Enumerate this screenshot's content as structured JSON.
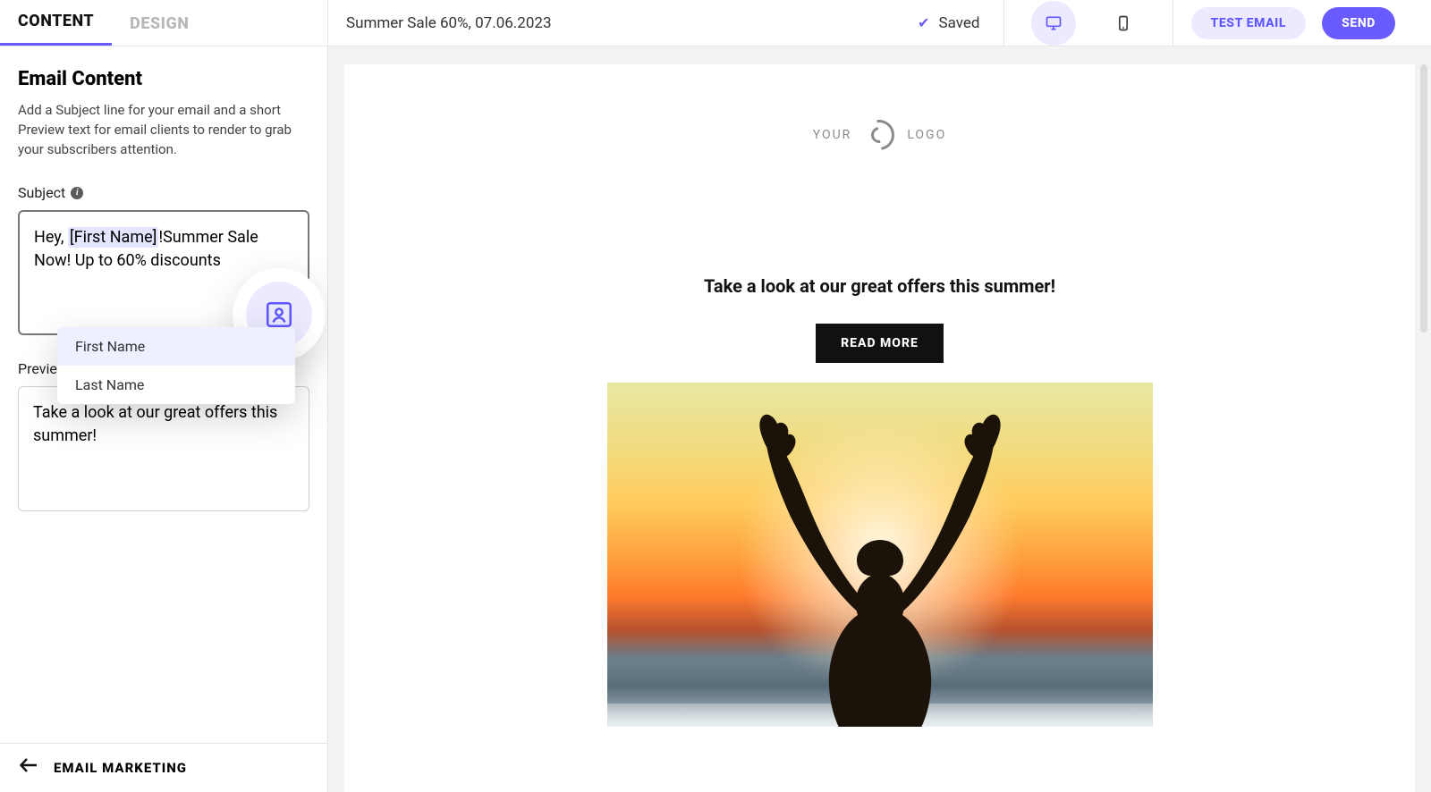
{
  "sidebar": {
    "tabs": {
      "content": "CONTENT",
      "design": "DESIGN"
    },
    "panel_title": "Email Content",
    "panel_desc": "Add a Subject line for your email and a short Preview text for email clients to render to grab your subscribers attention.",
    "subject_label": "Subject",
    "subject_before": "Hey, ",
    "subject_token": "[First Name]",
    "subject_after": "!Summer Sale Now! Up to 60% discounts",
    "preview_label": "Preview text",
    "preview_value": "Take a look at our great offers this summer!",
    "dropdown": {
      "first_name": "First Name",
      "last_name": "Last Name"
    },
    "footer_label": "EMAIL MARKETING"
  },
  "topbar": {
    "campaign_name": "Summer Sale 60%, 07.06.2023",
    "saved_label": "Saved",
    "test_email": "TEST EMAIL",
    "send": "SEND"
  },
  "canvas": {
    "brand_left": "YOUR",
    "brand_right": "LOGO",
    "headline": "Take a look at our great offers this summer!",
    "cta": "READ MORE"
  },
  "icons": {
    "info": "i",
    "check": "✔",
    "back_arrow": "←"
  }
}
